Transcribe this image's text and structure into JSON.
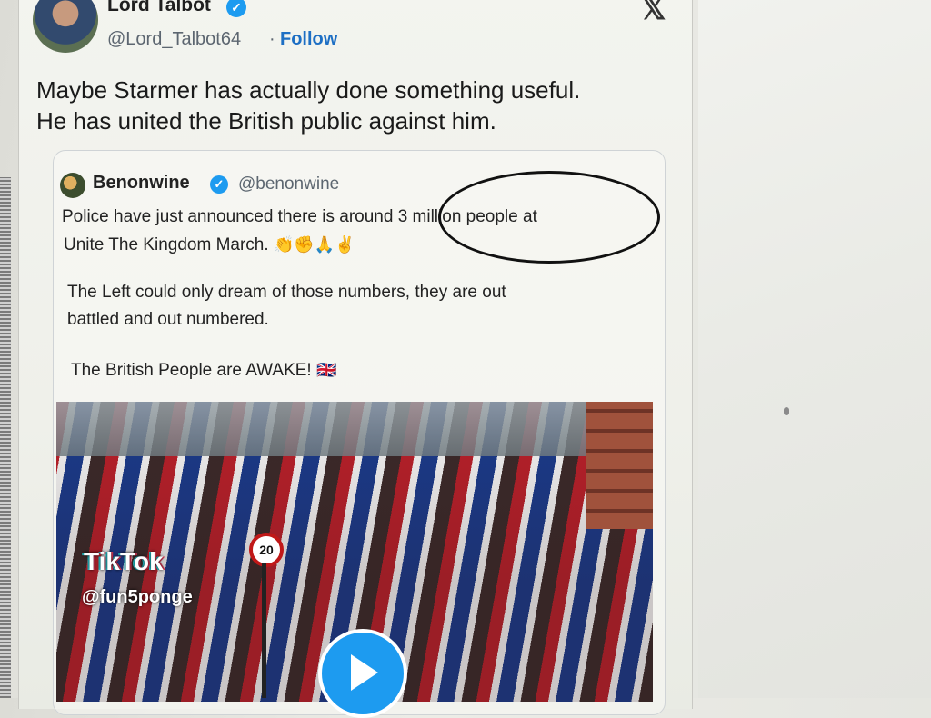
{
  "tweet": {
    "display_name": "Lord Talbot",
    "handle": "@Lord_Talbot64",
    "separator": "·",
    "follow_label": "Follow",
    "x_logo": "𝕏",
    "verified_glyph": "✓",
    "text_line1": "Maybe Starmer has actually done something useful.",
    "text_line2": "He has united the British public against him."
  },
  "quote": {
    "display_name": "Benonwine",
    "handle": "@benonwine",
    "verified_glyph": "✓",
    "para1_line1": "Police have just announced there is around 3 million people at",
    "para1_line2": "Unite The Kingdom March.",
    "emojis": "👏✊🙏✌",
    "para2_line1": "The Left could only dream of those numbers, they are out",
    "para2_line2": "battled and out numbered.",
    "para3": "The British People are AWAKE!",
    "flag_emoji": "🇬🇧"
  },
  "video": {
    "watermark_brand": "TikTok",
    "watermark_handle": "@fun5ponge",
    "speed_sign": "20",
    "play_icon": "play-icon"
  },
  "colors": {
    "accent": "#1d9bf0",
    "follow": "#1d6fc4",
    "annotation_ellipse": "#111111"
  }
}
